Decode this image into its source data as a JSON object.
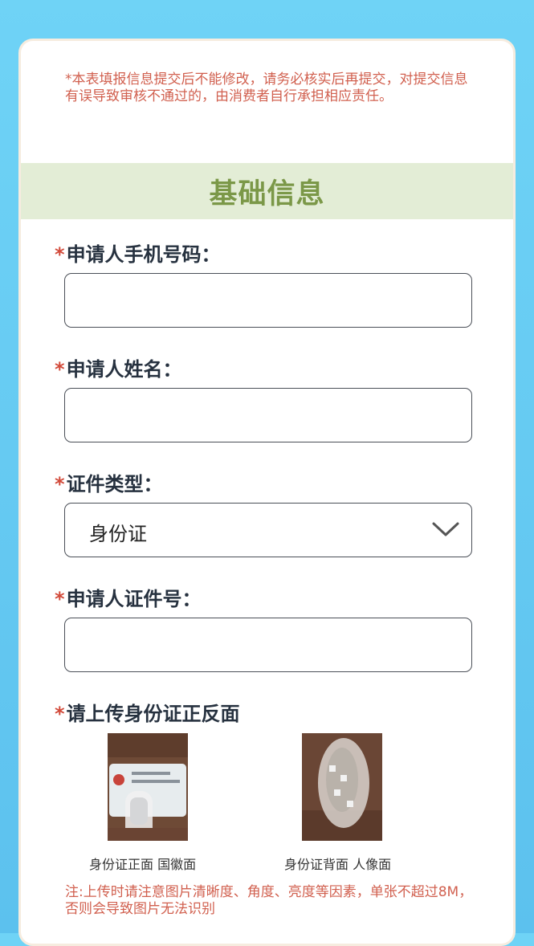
{
  "notice": "*本表填报信息提交后不能修改，请务必核实后再提交，对提交信息有误导致审核不通过的，由消费者自行承担相应责任。",
  "section_title": "基础信息",
  "fields": {
    "required_mark": "*",
    "phone": {
      "label": "申请人手机号码：",
      "value": ""
    },
    "name": {
      "label": "申请人姓名：",
      "value": ""
    },
    "id_type": {
      "label": "证件类型：",
      "selected": "身份证"
    },
    "id_number": {
      "label": "申请人证件号：",
      "value": ""
    },
    "upload": {
      "label": "请上传身份证正反面",
      "front_caption": "身份证正面 国徽面",
      "back_caption": "身份证背面 人像面"
    }
  },
  "note": "注:上传时请注意图片清晰度、角度、亮度等因素，单张不超过8M， 否则会导致图片无法识别",
  "colors": {
    "accent_red": "#d24a3a",
    "section_green": "#7b9848",
    "section_bg": "#e3edd6"
  },
  "icons": {
    "dropdown": "chevron-down-icon"
  }
}
